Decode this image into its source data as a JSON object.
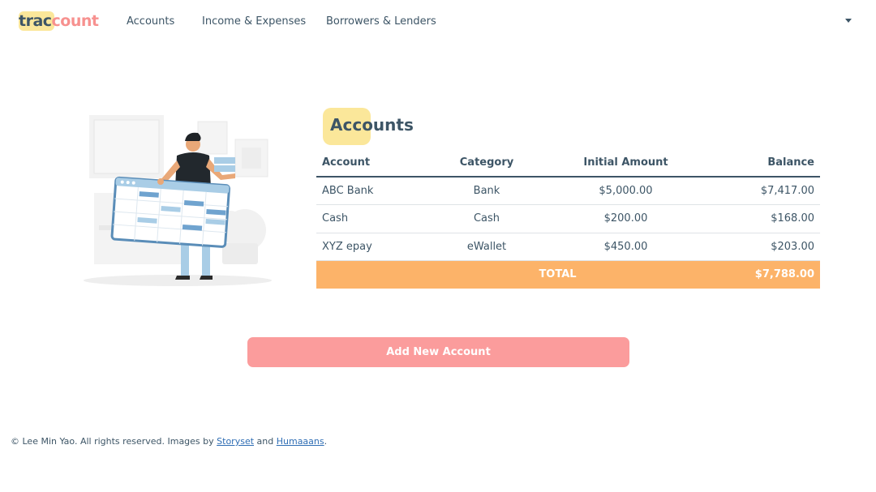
{
  "brand": {
    "part1": "trac",
    "part2": "count"
  },
  "nav": {
    "links": [
      "Accounts",
      "Income & Expenses",
      "Borrowers & Lenders"
    ]
  },
  "page": {
    "title": "Accounts"
  },
  "table": {
    "headers": [
      "Account",
      "Category",
      "Initial Amount",
      "Balance"
    ],
    "rows": [
      {
        "account": "ABC Bank",
        "category": "Bank",
        "initial": "$5,000.00",
        "balance": "$7,417.00"
      },
      {
        "account": "Cash",
        "category": "Cash",
        "initial": "$200.00",
        "balance": "$168.00"
      },
      {
        "account": "XYZ epay",
        "category": "eWallet",
        "initial": "$450.00",
        "balance": "$203.00"
      }
    ],
    "total": {
      "label": "TOTAL",
      "balance": "$7,788.00"
    }
  },
  "actions": {
    "add_account_label": "Add New Account"
  },
  "footer": {
    "text_before": "© Lee Min Yao. All rights reserved. Images by ",
    "link1": "Storyset",
    "text_middle": " and ",
    "link2": "Humaaans",
    "text_after": "."
  },
  "colors": {
    "text": "#3d5566",
    "highlight": "#fbe79a",
    "accent_pink": "#f7918f",
    "button": "#fb9c9c",
    "total_row": "#fcb369"
  },
  "icons": {
    "menu_caret": "caret-down-icon",
    "illustration": "person-holding-calendar-illustration"
  }
}
